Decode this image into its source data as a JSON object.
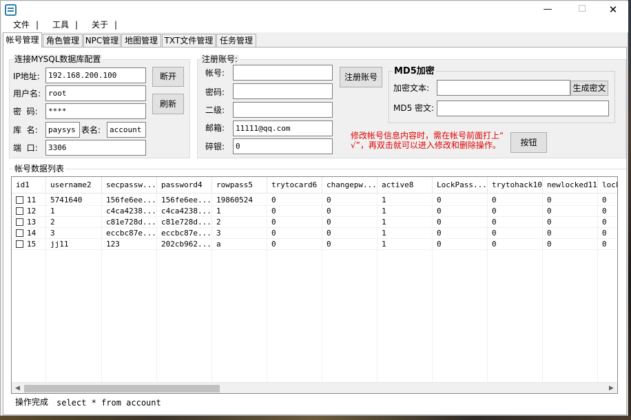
{
  "titlebar": {
    "minimize": "—",
    "maximize": "☐",
    "close": "✕"
  },
  "menu": [
    "文件",
    "工具",
    "关于"
  ],
  "tabs": [
    "帐号管理",
    "角色管理",
    "NPC管理",
    "地图管理",
    "TXT文件管理",
    "任务管理"
  ],
  "db_config": {
    "title": "连接MYSQL数据库配置",
    "ip_label": "IP地址:",
    "ip": "192.168.200.100",
    "user_label": "用户名:",
    "user": "root",
    "pass_label": "密  码:",
    "pass": "****",
    "db_label": "库  名:",
    "db": "paysys",
    "table_label": "表名:",
    "table": "account",
    "port_label": "端  口:",
    "port": "3306",
    "disconnect": "断开",
    "refresh": "刷新"
  },
  "register": {
    "title": "注册账号:",
    "account_label": "帐号:",
    "account": "",
    "password_label": "密码:",
    "password": "",
    "second_label": "二级:",
    "second": "",
    "email_label": "邮箱:",
    "email": "11111@qq.com",
    "silver_label": "碎银:",
    "silver": "0",
    "register_button": "注册账号",
    "hint_line1": "修改帐号信息内容时，需在帐号前面打上“",
    "hint_line2": "√”，再双击就可以进入修改和删除操作。",
    "action_button": "按钮"
  },
  "md5": {
    "title": "MD5加密",
    "plain_label": "加密文本:",
    "plain": "",
    "gen_button": "生成密文",
    "cipher_label": "MD5 密文:",
    "cipher": ""
  },
  "grid": {
    "title": "帐号数据列表",
    "columns": [
      "id1",
      "username2",
      "secpassw...",
      "password4",
      "rowpass5",
      "trytocard6",
      "changepw...",
      "active8",
      "LockPass...",
      "trytohack10",
      "newlocked11",
      "lock"
    ],
    "rows": [
      [
        "11",
        "5741640",
        "156fe6ee...",
        "156fe6ee...",
        "19860524",
        "0",
        "0",
        "1",
        "0",
        "0",
        "0",
        "0"
      ],
      [
        "12",
        "1",
        "c4ca4238...",
        "c4ca4238...",
        "1",
        "0",
        "0",
        "1",
        "0",
        "0",
        "0",
        "0"
      ],
      [
        "13",
        "2",
        "c81e728d...",
        "c81e728d...",
        "2",
        "0",
        "0",
        "1",
        "0",
        "0",
        "0",
        "0"
      ],
      [
        "14",
        "3",
        "eccbc87e...",
        "eccbc87e...",
        "3",
        "0",
        "0",
        "1",
        "0",
        "0",
        "0",
        "0"
      ],
      [
        "15",
        "jj11",
        "123",
        "202cb962...",
        "a",
        "0",
        "0",
        "1",
        "0",
        "0",
        "0",
        "0"
      ]
    ],
    "scroll_left": "◀",
    "scroll_right": "▶"
  },
  "status": {
    "text": "操作完成",
    "sql": "select * from account"
  },
  "colors": {
    "hint": "#e00000",
    "frame_border": "#adadad",
    "icon": "#2a7fa8"
  },
  "icons": {
    "app": "app-icon"
  }
}
